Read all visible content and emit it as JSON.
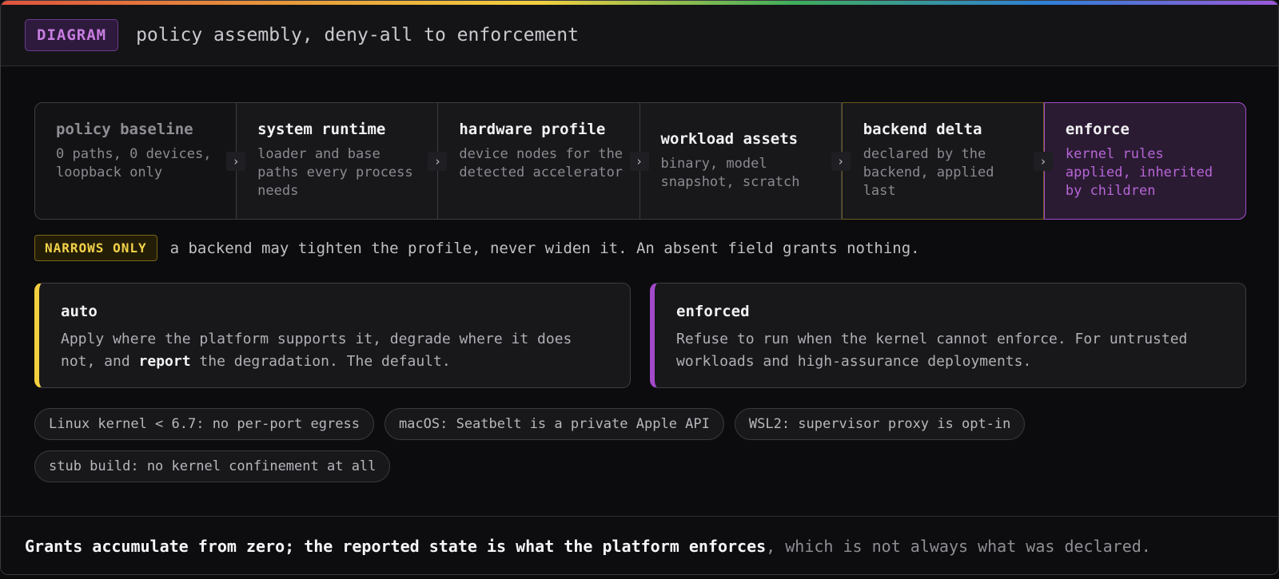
{
  "header": {
    "tag": "DIAGRAM",
    "title": "policy assembly, deny-all to enforcement"
  },
  "pipeline": [
    {
      "title": "policy baseline",
      "desc": "0 paths, 0 devices, loopback only"
    },
    {
      "title": "system runtime",
      "desc": "loader and base paths every process needs"
    },
    {
      "title": "hardware profile",
      "desc": "device nodes for the detected accelerator"
    },
    {
      "title": "workload assets",
      "desc": "binary, model snapshot, scratch"
    },
    {
      "title": "backend delta",
      "desc": "declared by the backend, applied last"
    },
    {
      "title": "enforce",
      "desc": "kernel rules applied, inherited by children"
    }
  ],
  "arrow_glyph": "›",
  "narrows": {
    "tag": "NARROWS ONLY",
    "text": "a backend may tighten the profile, never widen it. An absent field grants nothing."
  },
  "modes": {
    "auto": {
      "title": "auto",
      "desc_before": "Apply where the platform supports it, degrade where it does not, and ",
      "desc_bold": "report",
      "desc_after": " the degradation. The default."
    },
    "enforced": {
      "title": "enforced",
      "desc": "Refuse to run when the kernel cannot enforce. For untrusted workloads and high-assurance deployments."
    }
  },
  "caveats": [
    "Linux kernel < 6.7: no per-port egress",
    "macOS: Seatbelt is a private Apple API",
    "WSL2: supervisor proxy is opt-in",
    "stub build: no kernel confinement at all"
  ],
  "footer": {
    "strong": "Grants accumulate from zero; the reported state is what the platform enforces",
    "rest": ", which is not always what was declared."
  },
  "colors": {
    "accent_purple": "#a24ac9",
    "accent_yellow": "#f4d03f",
    "background": "#0c0c0e"
  }
}
